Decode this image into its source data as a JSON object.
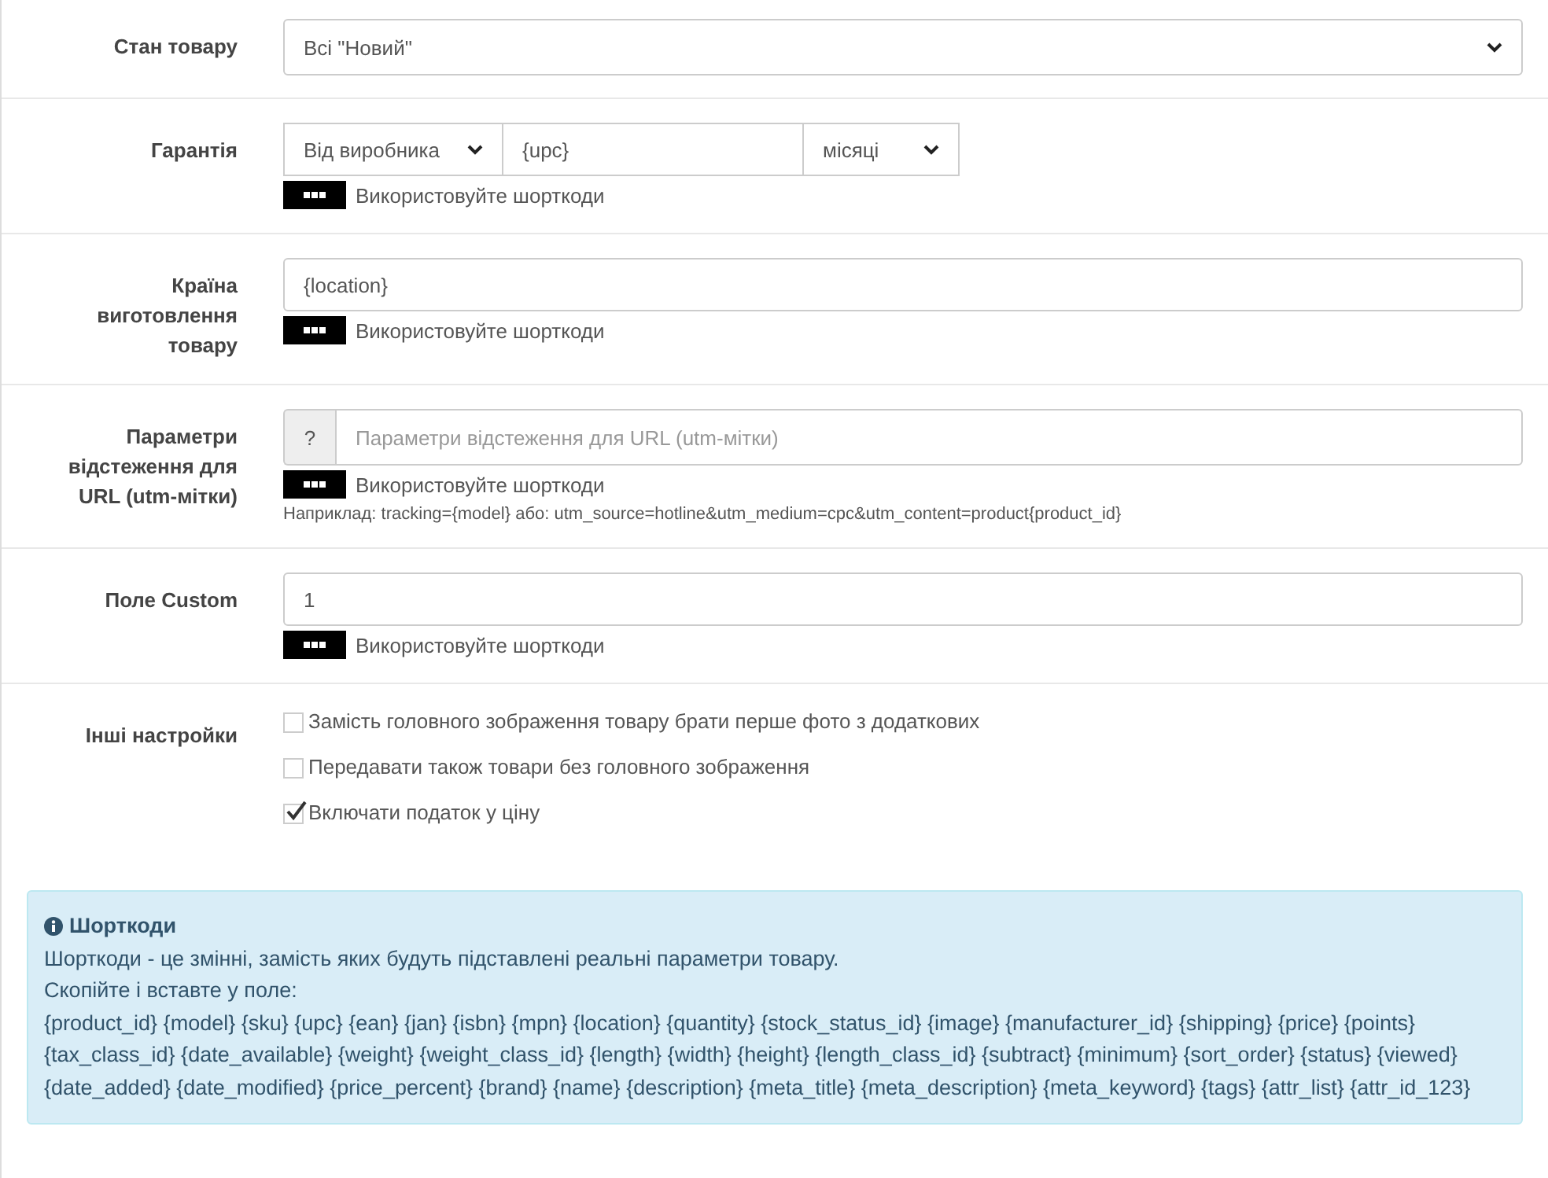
{
  "rows": [
    {
      "kind": "select",
      "label": "Стан товару",
      "value": "Всі \"Новий\""
    },
    {
      "kind": "warranty",
      "label": "Гарантія",
      "source": "Від виробника",
      "value": "{upc}",
      "unit": "місяці",
      "hint": "Використовуйте шорткоди"
    },
    {
      "kind": "text",
      "label": "Країна виготовлення товару",
      "value": "{location}",
      "hint": "Використовуйте шорткоди"
    },
    {
      "kind": "addon",
      "label": "Параметри відстеження для URL (utm-мітки)",
      "addon": "?",
      "placeholder": "Параметри відстеження для URL (utm-мітки)",
      "hint": "Використовуйте шорткоди",
      "example": "Наприклад: tracking={model} або: utm_source=hotline&utm_medium=cpc&utm_content=product{product_id}"
    },
    {
      "kind": "text",
      "label": "Поле Custom",
      "value": "1",
      "hint": "Використовуйте шорткоди"
    },
    {
      "kind": "checks",
      "label": "Інші настройки",
      "options": [
        {
          "label": "Замість головного зображення товару брати перше фото з додаткових",
          "checked": false
        },
        {
          "label": "Передавати також товари без головного зображення",
          "checked": false
        },
        {
          "label": "Включати податок у ціну",
          "checked": true
        }
      ]
    }
  ],
  "info": {
    "title": "Шорткоди",
    "lines": [
      "Шорткоди - це змінні, замість яких будуть підставлені реальні параметри товару.",
      "Скопійте і вставте у поле:"
    ],
    "codes": "{product_id} {model} {sku} {upc} {ean} {jan} {isbn} {mpn} {location} {quantity} {stock_status_id} {image} {manufacturer_id} {shipping} {price} {points} {tax_class_id} {date_available} {weight} {weight_class_id} {length} {width} {height} {length_class_id} {subtract} {minimum} {sort_order} {status} {viewed} {date_added} {date_modified} {price_percent} {brand} {name} {description} {meta_title} {meta_description} {meta_keyword} {tags} {attr_list} {attr_id_123}"
  }
}
